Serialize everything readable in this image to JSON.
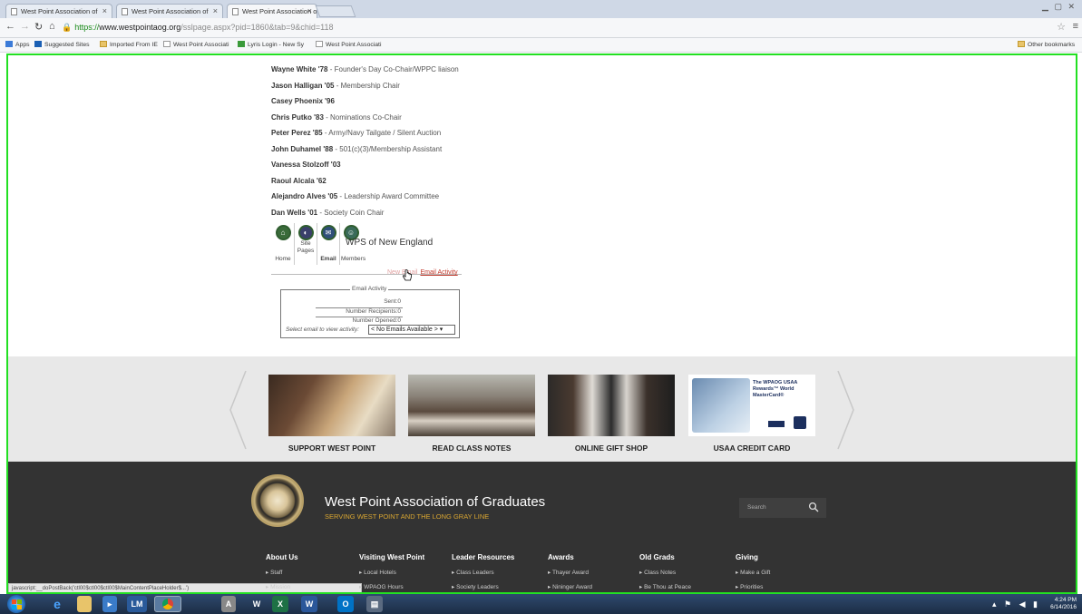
{
  "browser": {
    "tabs": [
      {
        "title": "West Point Association of"
      },
      {
        "title": "West Point Association of"
      },
      {
        "title": "West Point Association of"
      }
    ],
    "url": {
      "https": "https://",
      "host": "www.westpointaog.org",
      "path": "/sslpage.aspx?pid=1860&tab=9&chid=118"
    },
    "bookmarks": [
      "Apps",
      "Suggested Sites",
      "Imported From IE",
      "West Point Associati",
      "Lyris Login - New Sy",
      "West Point Associati"
    ],
    "other_bookmarks": "Other bookmarks"
  },
  "officers": [
    {
      "name": "Wayne White '78",
      "role": " - Founder's Day Co-Chair/WPPC liaison"
    },
    {
      "name": "Jason Halligan '05",
      "role": " - Membership Chair"
    },
    {
      "name": "Casey Phoenix '96",
      "role": ""
    },
    {
      "name": "Chris Putko '83",
      "role": " - Nominations Co-Chair"
    },
    {
      "name": "Peter Perez '85",
      "role": " - Army/Navy Tailgate / Silent Auction"
    },
    {
      "name": "John Duhamel '88",
      "role": " - 501(c)(3)/Membership Assistant"
    },
    {
      "name": "Vanessa Stolzoff '03",
      "role": ""
    },
    {
      "name": "Raoul Alcala '62",
      "role": ""
    },
    {
      "name": "Alejandro Alves '05",
      "role": " - Leadership Award Committee"
    },
    {
      "name": "Dan Wells '01",
      "role": " - Society Coin Chair"
    }
  ],
  "group_tools": {
    "home": "Home",
    "site_pages_1": "Site",
    "site_pages_2": "Pages",
    "email": "Email",
    "members": "Members",
    "group_name": "WPS of New England"
  },
  "email_tabs": {
    "new_email": "New Email",
    "email_activity": "Email Activity"
  },
  "email_activity": {
    "legend": "Email Activity",
    "sent": "Sent:0",
    "recipients": "Number Recipients:0",
    "opened": "Number Opened:0",
    "select_label": "Select email to view activity:",
    "select_value": "< No Emails Available >"
  },
  "promos": [
    {
      "caption": "SUPPORT WEST POINT"
    },
    {
      "caption": "READ CLASS NOTES"
    },
    {
      "caption": "ONLINE GIFT SHOP"
    },
    {
      "caption": "USAA CREDIT CARD"
    }
  ],
  "card_text": "The WPAOG USAA Rewards™ World MasterCard®",
  "footer": {
    "title": "West Point Association of Graduates",
    "tagline": "SERVING WEST POINT AND THE LONG GRAY LINE",
    "search_placeholder": "Search",
    "columns": [
      {
        "heading": "About Us",
        "links": [
          "Staff",
          "Mission"
        ]
      },
      {
        "heading": "Visiting West Point",
        "links": [
          "Local Hotels",
          "WPAOG Hours"
        ]
      },
      {
        "heading": "Leader Resources",
        "links": [
          "Class Leaders",
          "Society Leaders"
        ]
      },
      {
        "heading": "Awards",
        "links": [
          "Thayer Award",
          "Nininger Award"
        ]
      },
      {
        "heading": "Old Grads",
        "links": [
          "Class Notes",
          "Be Thou at Peace"
        ]
      },
      {
        "heading": "Giving",
        "links": [
          "Make a Gift",
          "Priorities"
        ]
      }
    ]
  },
  "status_text": "javascript:__doPostBack('ctl00$ctl00$ctl00$MainContentPlaceHolder$...')",
  "taskbar": {
    "lm": "LM",
    "time": "4:24 PM",
    "date": "6/14/2016"
  },
  "colors": {
    "accent_gold": "#d9a632",
    "footer_bg": "#333333",
    "highlight_border": "#22e022",
    "link_red": "#c0392b"
  }
}
